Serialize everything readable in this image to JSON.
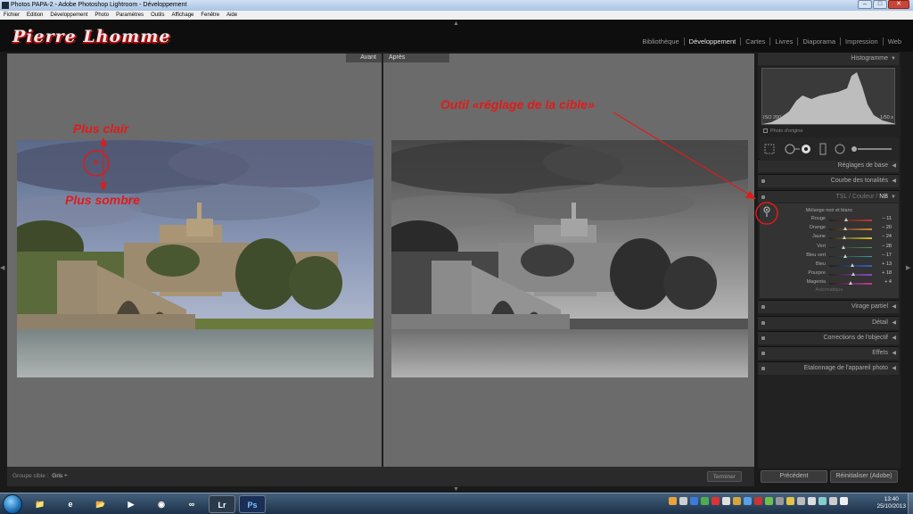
{
  "window": {
    "title": "Photos PAPA-2 - Adobe Photoshop Lightroom - Développement",
    "controls": [
      "–",
      "□",
      "✕"
    ]
  },
  "menubar": [
    "Fichier",
    "Edition",
    "Développement",
    "Photo",
    "Paramètres",
    "Outils",
    "Affichage",
    "Fenêtre",
    "Aide"
  ],
  "identity_plate": "Pierre Lhomme",
  "modules": [
    {
      "label": "Bibliothèque",
      "active": false
    },
    {
      "label": "Développement",
      "active": true
    },
    {
      "label": "Cartes",
      "active": false
    },
    {
      "label": "Livres",
      "active": false
    },
    {
      "label": "Diaporama",
      "active": false
    },
    {
      "label": "Impression",
      "active": false
    },
    {
      "label": "Web",
      "active": false
    }
  ],
  "view": {
    "before_label": "Avant",
    "after_label": "Après"
  },
  "toolbar": {
    "target_group_label": "Groupe cible :",
    "target_group_value": "Gris ÷",
    "finish_label": "Terminer"
  },
  "histogram": {
    "title": "Histogramme",
    "iso": "ISO 200",
    "focal": "50 mm",
    "aperture": "f / 8,0",
    "shutter": "1/50 s",
    "photo_origin": "Photo d'origine"
  },
  "panels": {
    "basic": "Réglages de base",
    "tone_curve": "Courbe des tonalités",
    "split_toning": "Virage partiel",
    "detail": "Détail",
    "lens": "Corrections de l'objectif",
    "effects": "Effets",
    "camera_cal": "Etalonnage de l'appareil photo"
  },
  "hsl_tabs": [
    "TSL",
    "/",
    "Couleur",
    "/",
    "NB"
  ],
  "bw_mix": {
    "title": "Mélange noir et blanc",
    "auto_label": "Automatique",
    "sliders": [
      {
        "label": "Rouge",
        "value": "– 11",
        "pos": 0.41,
        "color": "#c0392b"
      },
      {
        "label": "Orange",
        "value": "– 20",
        "pos": 0.38,
        "color": "#d9822b"
      },
      {
        "label": "Jaune",
        "value": "– 24",
        "pos": 0.36,
        "color": "#d4c12c"
      },
      {
        "label": "Vert",
        "value": "– 28",
        "pos": 0.35,
        "color": "#3fa34d"
      },
      {
        "label": "Bleu vert",
        "value": "– 17",
        "pos": 0.39,
        "color": "#2fa5a5"
      },
      {
        "label": "Bleu",
        "value": "+ 13",
        "pos": 0.55,
        "color": "#3060c0"
      },
      {
        "label": "Pourpre",
        "value": "+ 18",
        "pos": 0.57,
        "color": "#8a4bbf"
      },
      {
        "label": "Magenta",
        "value": "+ 4",
        "pos": 0.51,
        "color": "#c03a9a"
      }
    ]
  },
  "buttons": {
    "previous": "Précédent",
    "reset": "Réinitialiser (Adobe)"
  },
  "annotations": {
    "lighter": "Plus clair",
    "darker": "Plus sombre",
    "tool": "Outil «réglage de la cible»",
    "crosshair": "+"
  },
  "taskbar": {
    "apps": [
      {
        "name": "explorer-folder-icon",
        "label": "📁"
      },
      {
        "name": "ie-icon",
        "label": "e"
      },
      {
        "name": "folder-icon",
        "label": "📂"
      },
      {
        "name": "media-player-icon",
        "label": "▶"
      },
      {
        "name": "firefox-icon",
        "label": "◉"
      },
      {
        "name": "vs-icon",
        "label": "∞"
      },
      {
        "name": "lightroom-icon",
        "label": "Lr"
      },
      {
        "name": "photoshop-icon",
        "label": "Ps"
      }
    ],
    "clock_time": "13:40",
    "clock_date": "25/10/2013"
  }
}
